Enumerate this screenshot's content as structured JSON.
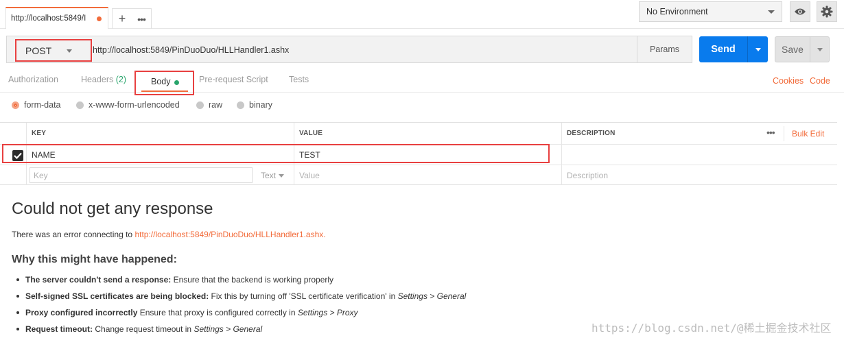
{
  "request_tab": {
    "label": "http://localhost:5849/I"
  },
  "tab_actions": {
    "add": "+",
    "more": "•••"
  },
  "environment": {
    "selected": "No Environment"
  },
  "request": {
    "method": "POST",
    "url": "http://localhost:5849/PinDuoDuo/HLLHandler1.ashx",
    "params_label": "Params",
    "send_label": "Send",
    "save_label": "Save"
  },
  "subtabs": {
    "authorization": "Authorization",
    "headers": "Headers",
    "headers_count": "(2)",
    "body": "Body",
    "prerequest": "Pre-request Script",
    "tests": "Tests",
    "cookies": "Cookies",
    "code": "Code"
  },
  "body_modes": [
    "form-data",
    "x-www-form-urlencoded",
    "raw",
    "binary"
  ],
  "table": {
    "headers": {
      "key": "KEY",
      "value": "VALUE",
      "description": "DESCRIPTION"
    },
    "bulk_edit": "Bulk Edit",
    "menu": "•••",
    "rows": [
      {
        "key": "NAME",
        "value": "TEST",
        "description": ""
      }
    ],
    "new_row": {
      "key_placeholder": "Key",
      "type": "Text",
      "value_placeholder": "Value",
      "description_placeholder": "Description"
    }
  },
  "response": {
    "title": "Could not get any response",
    "error_prefix": "There was an error connecting to ",
    "error_link": "http://localhost:5849/PinDuoDuo/HLLHandler1.ashx.",
    "why_heading": "Why this might have happened:",
    "reasons": [
      {
        "bold": "The server couldn't send a response:",
        "text": " Ensure that the backend is working properly",
        "italic": ""
      },
      {
        "bold": "Self-signed SSL certificates are being blocked:",
        "text": " Fix this by turning off 'SSL certificate verification' in ",
        "italic": "Settings > General"
      },
      {
        "bold": "Proxy configured incorrectly",
        "text": " Ensure that proxy is configured correctly in ",
        "italic": "Settings > Proxy"
      },
      {
        "bold": "Request timeout:",
        "text": " Change request timeout in ",
        "italic": "Settings > General"
      }
    ]
  },
  "watermark": "https://blog.csdn.net/@稀土掘金技术社区",
  "colors": {
    "accent": "#f26b3a",
    "send": "#097bed",
    "highlight": "#e84040",
    "success": "#29a56c"
  },
  "icons": {
    "eye": "eye-icon",
    "settings": "gear-icon"
  }
}
